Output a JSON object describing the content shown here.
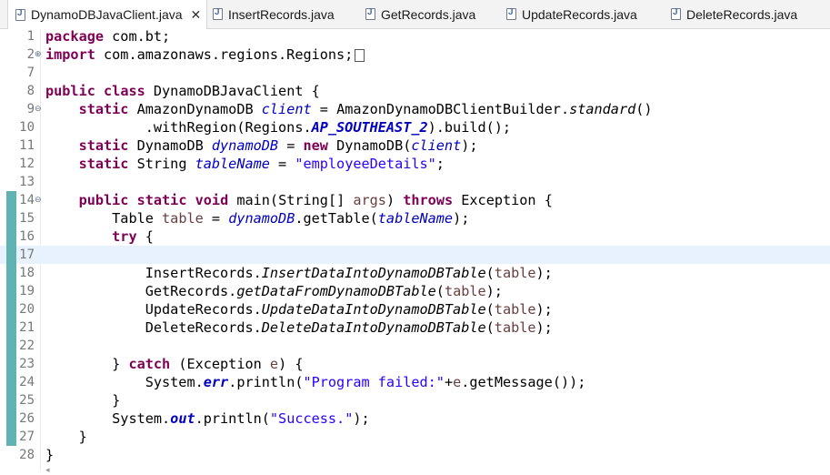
{
  "tabs": [
    {
      "label": "DynamoDBJavaClient.java",
      "active": true
    },
    {
      "label": "InsertRecords.java",
      "active": false
    },
    {
      "label": "GetRecords.java",
      "active": false
    },
    {
      "label": "UpdateRecords.java",
      "active": false
    },
    {
      "label": "DeleteRecords.java",
      "active": false
    }
  ],
  "tab_close_symbol": "✕",
  "line_numbers": [
    "1",
    "2",
    "7",
    "8",
    "9",
    "10",
    "11",
    "12",
    "13",
    "14",
    "15",
    "16",
    "17",
    "18",
    "19",
    "20",
    "21",
    "22",
    "23",
    "24",
    "25",
    "26",
    "27",
    "28"
  ],
  "code": {
    "l1": {
      "kw": "package",
      "rest": " com.bt;"
    },
    "l2": {
      "kw": "import",
      "rest": " com.amazonaws.regions.Regions;"
    },
    "l8": {
      "kw1": "public",
      "kw2": "class",
      "rest": " DynamoDBJavaClient {"
    },
    "l9": {
      "kw": "static",
      "type": " AmazonDynamoDB ",
      "field": "client",
      "mid": " = AmazonDynamoDBClientBuilder.",
      "sm": "standard",
      "end": "()"
    },
    "l10": {
      "pre": ".withRegion(Regions.",
      "const": "AP_SOUTHEAST_2",
      "end": ").build();"
    },
    "l11": {
      "kw": "static",
      "type": " DynamoDB ",
      "field": "dynamoDB",
      "mid": " = ",
      "kw2": "new",
      "call": " DynamoDB(",
      "arg": "client",
      "end": ");"
    },
    "l12": {
      "kw": "static",
      "type": " String ",
      "field": "tableName",
      "mid": " = ",
      "str": "\"employeeDetails\"",
      "end": ";"
    },
    "l14": {
      "kw1": "public",
      "kw2": "static",
      "kw3": "void",
      "sig": " main(String[] ",
      "param": "args",
      "close": ") ",
      "kw4": "throws",
      "end": " Exception {"
    },
    "l15": {
      "type": "Table ",
      "var": "table",
      "mid": " = ",
      "field": "dynamoDB",
      "call": ".getTable(",
      "arg": "tableName",
      "end": ");"
    },
    "l16": {
      "kw": "try",
      "end": " {"
    },
    "l18": {
      "cls": "InsertRecords.",
      "sm": "InsertDataIntoDynamoDBTable",
      "open": "(",
      "arg": "table",
      "end": ");"
    },
    "l19": {
      "cls": "GetRecords.",
      "sm": "getDataFromDynamoDBTable",
      "open": "(",
      "arg": "table",
      "end": ");"
    },
    "l20": {
      "cls": "UpdateRecords.",
      "sm": "UpdateDataIntoDynamoDBTable",
      "open": "(",
      "arg": "table",
      "end": ");"
    },
    "l21": {
      "cls": "DeleteRecords.",
      "sm": "DeleteDataIntoDynamoDBTable",
      "open": "(",
      "arg": "table",
      "end": ");"
    },
    "l23": {
      "pre": "} ",
      "kw": "catch",
      "mid": " (Exception ",
      "var": "e",
      "end": ") {"
    },
    "l24": {
      "pre": "System.",
      "sfield": "err",
      "call": ".println(",
      "str": "\"Program failed:\"",
      "plus": "+",
      "var": "e",
      "end": ".getMessage());"
    },
    "l25": {
      "text": "}"
    },
    "l26": {
      "pre": "System.",
      "sfield": "out",
      "call": ".println(",
      "str": "\"Success.\"",
      "end": ");"
    },
    "l27": {
      "text": "}"
    },
    "l28": {
      "text": "}"
    }
  }
}
